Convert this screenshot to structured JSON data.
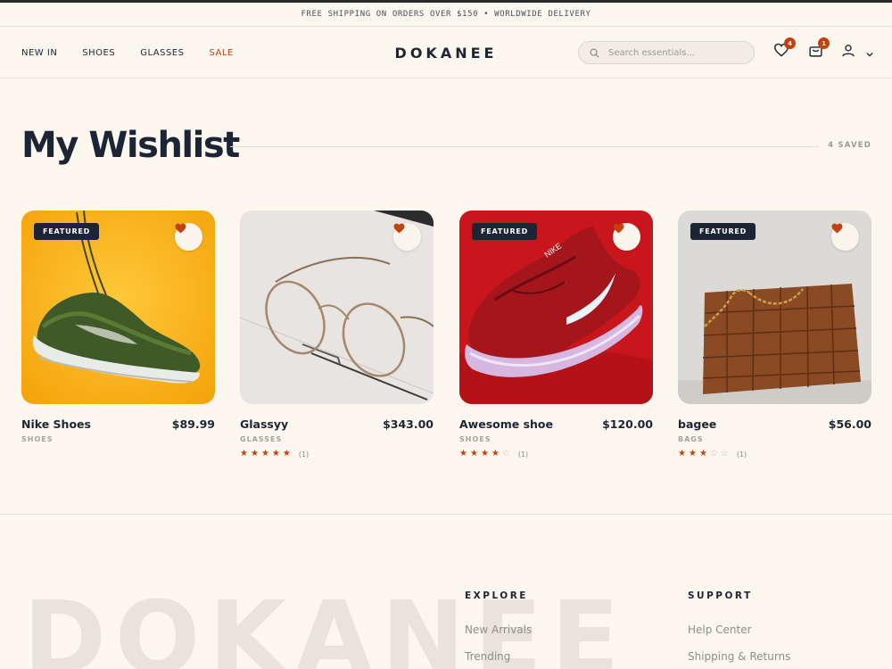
{
  "promo": "FREE SHIPPING ON ORDERS OVER $150 • WORLDWIDE DELIVERY",
  "nav": {
    "items": [
      "NEW IN",
      "SHOES",
      "GLASSES",
      "SALE"
    ]
  },
  "brand": "DOKANEE",
  "search": {
    "placeholder": "Search essentials..."
  },
  "header_icons": {
    "wishlist": {
      "icon": "heart-icon",
      "badge": "4"
    },
    "cart": {
      "icon": "bag-icon",
      "badge": "1"
    },
    "account": {
      "icon": "user-icon"
    }
  },
  "page": {
    "title": "My Wishlist",
    "saved_count": "4 SAVED"
  },
  "products": [
    {
      "name": "Nike Shoes",
      "price": "$89.99",
      "category": "SHOES",
      "featured": "FEATURED",
      "rating": null,
      "reviews": ""
    },
    {
      "name": "Glassyy",
      "price": "$343.00",
      "category": "GLASSES",
      "featured": "",
      "rating": 5,
      "reviews": "(1)"
    },
    {
      "name": "Awesome shoe",
      "price": "$120.00",
      "category": "SHOES",
      "featured": "FEATURED",
      "rating": 4,
      "reviews": "(1)"
    },
    {
      "name": "bagee",
      "price": "$56.00",
      "category": "BAGS",
      "featured": "FEATURED",
      "rating": 3,
      "reviews": "(1)"
    }
  ],
  "footer": {
    "watermark": "DOKANEE",
    "explore": {
      "title": "EXPLORE",
      "links": [
        "New Arrivals",
        "Trending"
      ]
    },
    "support": {
      "title": "SUPPORT",
      "links": [
        "Help Center",
        "Shipping & Returns"
      ]
    }
  },
  "colors": {
    "accent": "#c2410c",
    "navy": "#1c2536",
    "background": "#fbf7ee"
  }
}
